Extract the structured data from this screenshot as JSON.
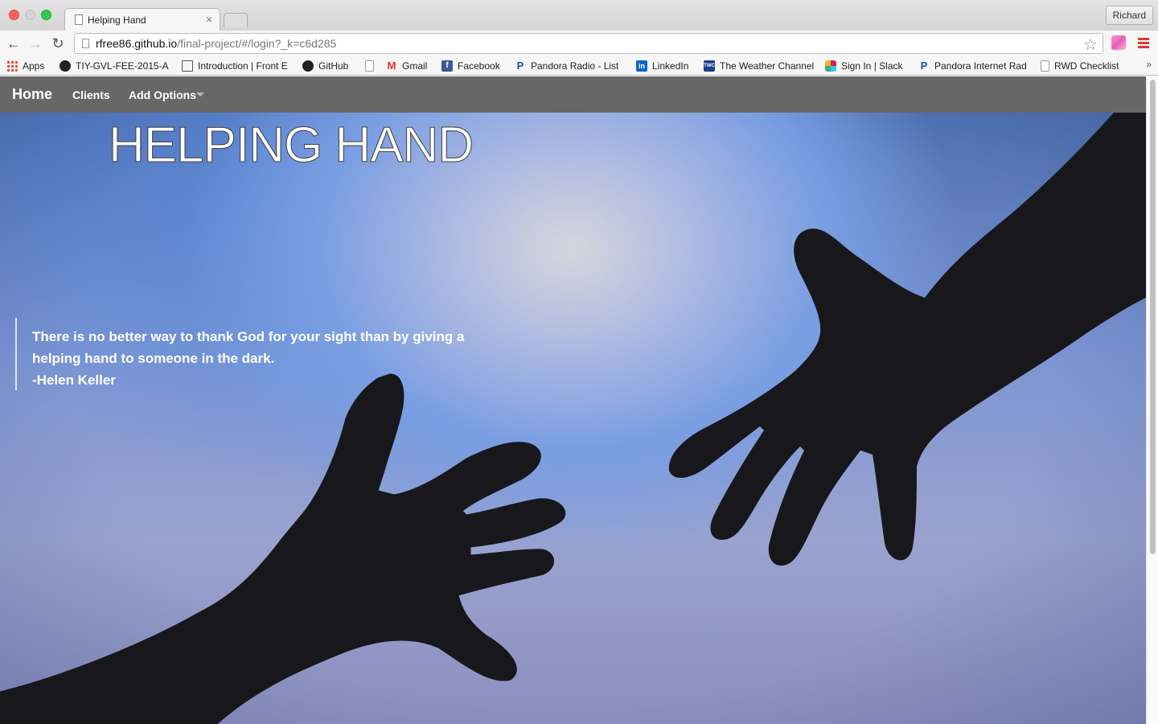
{
  "browser": {
    "tab_title": "Helping Hand",
    "tab_close": "×",
    "profile_name": "Richard",
    "url_host": "rfree86.github.io",
    "url_path": "/final-project/#/login?_k=c6d285",
    "back_glyph": "←",
    "forward_glyph": "→",
    "reload_glyph": "↻",
    "star_glyph": "☆",
    "bookmarks_overflow": "»",
    "bookmarks": [
      {
        "label": "Apps",
        "icon": "apps-grid-icon"
      },
      {
        "label": "TIY-GVL-FEE-2015-A",
        "icon": "github-icon"
      },
      {
        "label": "Introduction | Front E",
        "icon": "book-icon"
      },
      {
        "label": "GitHub",
        "icon": "github-icon"
      },
      {
        "label": "",
        "icon": "page-icon"
      },
      {
        "label": "Gmail",
        "icon": "gmail-icon"
      },
      {
        "label": "Facebook",
        "icon": "facebook-icon"
      },
      {
        "label": "Pandora Radio - List",
        "icon": "pandora-icon"
      },
      {
        "label": "LinkedIn",
        "icon": "linkedin-icon"
      },
      {
        "label": "The Weather Channel",
        "icon": "twc-icon"
      },
      {
        "label": "Sign In | Slack",
        "icon": "slack-icon"
      },
      {
        "label": "Pandora Internet Rad",
        "icon": "pandora-icon"
      },
      {
        "label": "RWD Checklist",
        "icon": "page-icon"
      }
    ]
  },
  "nav": {
    "brand": "Home",
    "clients": "Clients",
    "add_options": "Add Options"
  },
  "hero": {
    "title": "HELPING HAND",
    "quote_text": "There is no better way to thank God for your sight than by giving a helping hand to someone in the dark.",
    "quote_author": "-Helen Keller"
  },
  "colors": {
    "navbar": "#676767",
    "hand_silhouette": "#18181c",
    "sky_center": "#d6d6dc",
    "sky_blue": "#5b8fe0"
  }
}
